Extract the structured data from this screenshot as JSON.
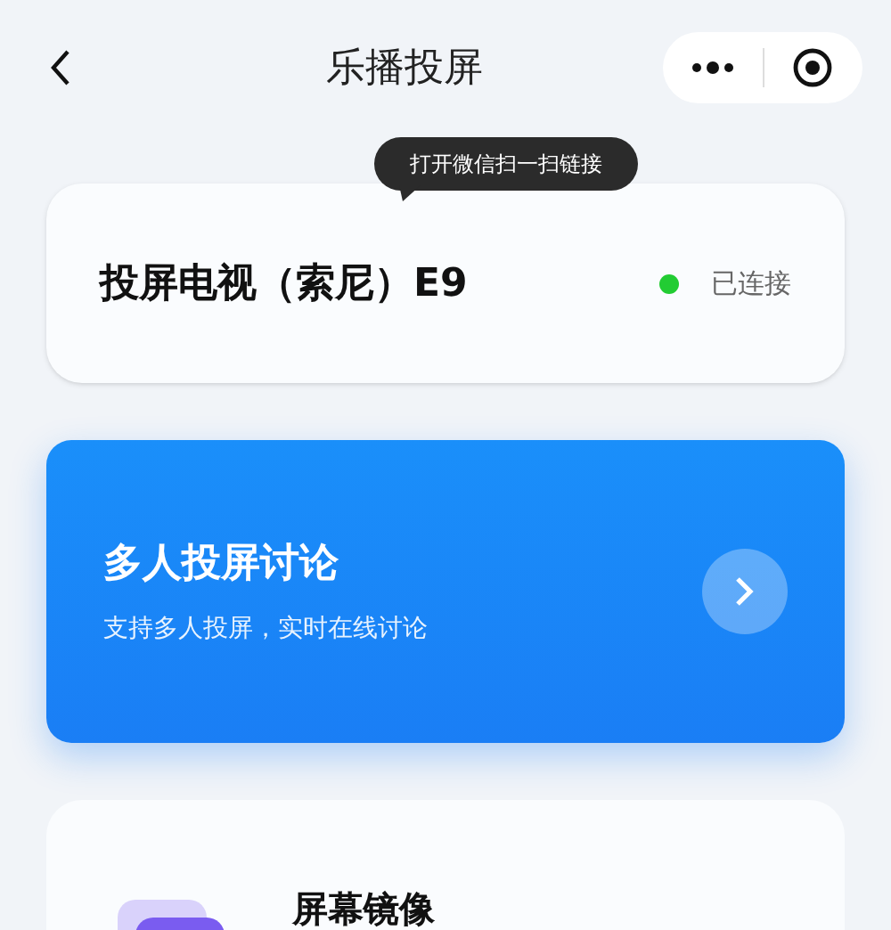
{
  "nav": {
    "title": "乐播投屏"
  },
  "tooltip": "打开微信扫一扫链接",
  "device": {
    "name": "投屏电视（索尼）E9",
    "status": "已连接",
    "connected": true
  },
  "promo": {
    "title": "多人投屏讨论",
    "subtitle": "支持多人投屏，实时在线讨论"
  },
  "features": [
    {
      "title": "屏幕镜像"
    }
  ]
}
